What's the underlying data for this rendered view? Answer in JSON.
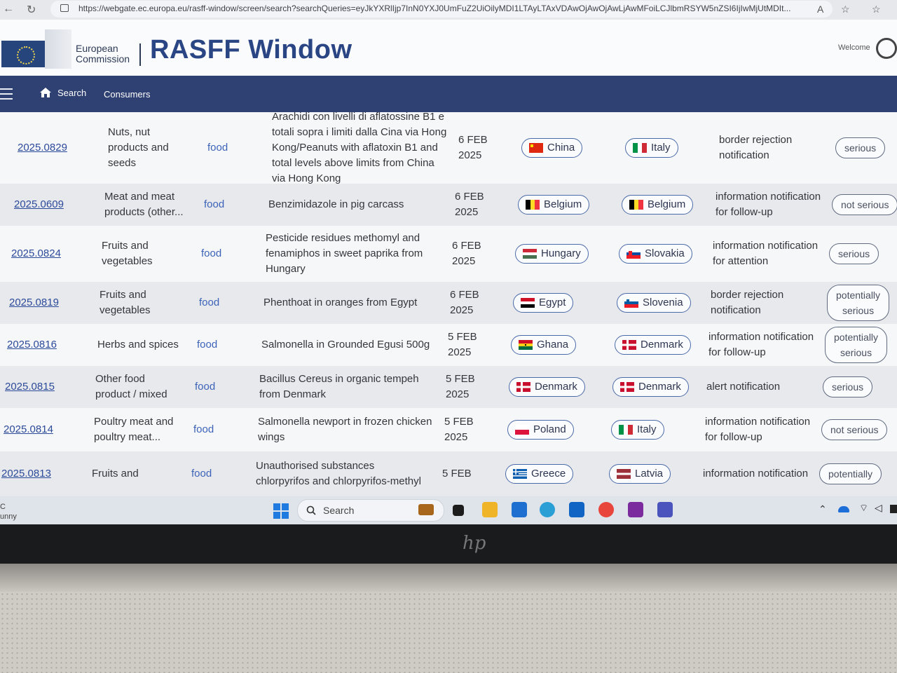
{
  "browser": {
    "url": "https://webgate.ec.europa.eu/rasff-window/screen/search?searchQueries=eyJkYXRlIjp7InN0YXJ0UmFuZ2UiOilyMDI1LTAyLTAxVDAwOjAwOjAwLjAwMFoiLCJlbmRSYW5nZSI6IjIwMjUtMDIt..."
  },
  "header": {
    "org_name_line1": "European",
    "org_name_line2": "Commission",
    "title": "RASFF Window",
    "welcome": "Welcome"
  },
  "nav": {
    "search": "Search",
    "consumers": "Consumers"
  },
  "rows": [
    {
      "reference": "2025.0829",
      "category": [
        "Nuts, nut",
        "products and",
        "seeds"
      ],
      "type": "food",
      "subject": [
        "Arachidi con livelli di aflatossine B1 e",
        "totali sopra i limiti dalla Cina via Hong",
        "Kong/Peanuts with aflatoxin B1 and",
        "total levels above limits from China",
        "via Hong Kong"
      ],
      "date": [
        "6 FEB",
        "2025"
      ],
      "origin": "China",
      "notifying": "Italy",
      "classification": [
        "border rejection",
        "notification"
      ],
      "risk": [
        "serious"
      ]
    },
    {
      "reference": "2025.0609",
      "category": [
        "Meat and meat",
        "products (other..."
      ],
      "type": "food",
      "subject": [
        "Benzimidazole in pig carcass"
      ],
      "date": [
        "6 FEB",
        "2025"
      ],
      "origin": "Belgium",
      "notifying": "Belgium",
      "classification": [
        "information notification",
        "for follow-up"
      ],
      "risk": [
        "not serious"
      ]
    },
    {
      "reference": "2025.0824",
      "category": [
        "Fruits and",
        "vegetables"
      ],
      "type": "food",
      "subject": [
        "Pesticide residues methomyl and",
        "fenamiphos in sweet paprika from",
        "Hungary"
      ],
      "date": [
        "6 FEB",
        "2025"
      ],
      "origin": "Hungary",
      "notifying": "Slovakia",
      "classification": [
        "information notification",
        "for attention"
      ],
      "risk": [
        "serious"
      ]
    },
    {
      "reference": "2025.0819",
      "category": [
        "Fruits and",
        "vegetables"
      ],
      "type": "food",
      "subject": [
        "Phenthoat in oranges from Egypt"
      ],
      "date": [
        "6 FEB",
        "2025"
      ],
      "origin": "Egypt",
      "notifying": "Slovenia",
      "classification": [
        "border rejection",
        "notification"
      ],
      "risk": [
        "potentially",
        "serious"
      ]
    },
    {
      "reference": "2025.0816",
      "category": [
        "Herbs and spices"
      ],
      "type": "food",
      "subject": [
        "Salmonella in Grounded Egusi 500g"
      ],
      "date": [
        "5 FEB",
        "2025"
      ],
      "origin": "Ghana",
      "notifying": "Denmark",
      "classification": [
        "information notification",
        "for follow-up"
      ],
      "risk": [
        "potentially",
        "serious"
      ]
    },
    {
      "reference": "2025.0815",
      "category": [
        "Other food",
        "product / mixed"
      ],
      "type": "food",
      "subject": [
        "Bacillus Cereus in organic tempeh",
        "from Denmark"
      ],
      "date": [
        "5 FEB",
        "2025"
      ],
      "origin": "Denmark",
      "notifying": "Denmark",
      "classification": [
        "alert notification"
      ],
      "risk": [
        "serious"
      ]
    },
    {
      "reference": "2025.0814",
      "category": [
        "Poultry meat and",
        "poultry meat..."
      ],
      "type": "food",
      "subject": [
        "Salmonella newport in frozen chicken",
        "wings"
      ],
      "date": [
        "5 FEB",
        "2025"
      ],
      "origin": "Poland",
      "notifying": "Italy",
      "classification": [
        "information notification",
        "for follow-up"
      ],
      "risk": [
        "not serious"
      ]
    },
    {
      "reference": "2025.0813",
      "category": [
        "Fruits and"
      ],
      "type": "food",
      "subject": [
        "Unauthorised substances",
        "chlorpyrifos and chlorpyrifos-methyl"
      ],
      "date": [
        "5 FEB"
      ],
      "origin": "Greece",
      "notifying": "Latvia",
      "classification": [
        "information notification"
      ],
      "risk": [
        "potentially"
      ]
    }
  ],
  "flags": {
    "China": "cn",
    "Italy": "it",
    "Belgium": "be",
    "Hungary": "hu",
    "Slovakia": "sk",
    "Egypt": "eg",
    "Slovenia": "si",
    "Ghana": "gh",
    "Denmark": "dk",
    "Poland": "pl",
    "Greece": "gr",
    "Latvia": "lv"
  },
  "taskbar": {
    "weather_line1": "C",
    "weather_line2": "unny",
    "search": "Search"
  },
  "laptop": {
    "brand": "hp"
  }
}
